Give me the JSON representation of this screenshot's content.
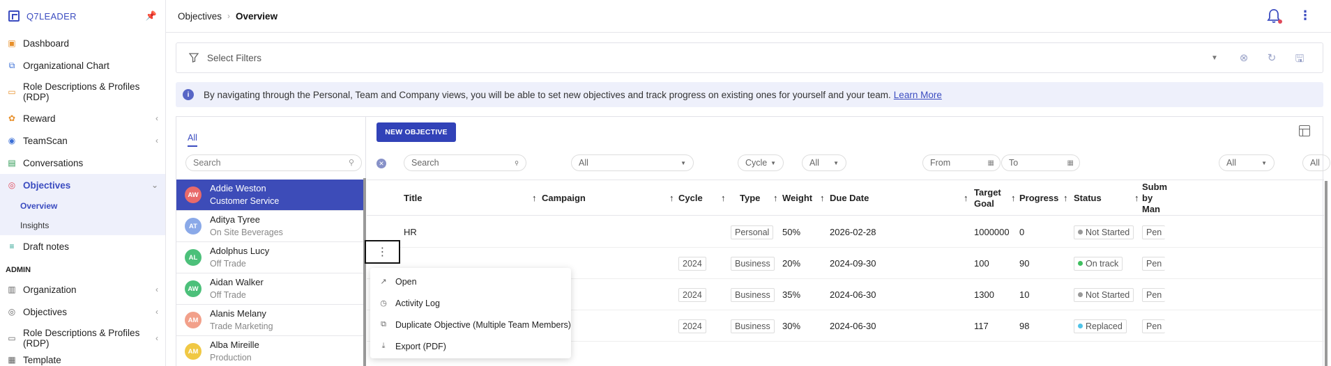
{
  "sidebar": {
    "brand": "Q7LEADER",
    "items": [
      {
        "label": "Dashboard"
      },
      {
        "label": "Organizational Chart"
      },
      {
        "label": "Role Descriptions & Profiles (RDP)"
      },
      {
        "label": "Reward"
      },
      {
        "label": "TeamScan"
      },
      {
        "label": "Conversations"
      },
      {
        "label": "Objectives"
      },
      {
        "label": "Draft notes"
      }
    ],
    "sub_items": [
      {
        "label": "Overview"
      },
      {
        "label": "Insights"
      }
    ],
    "admin_label": "ADMIN",
    "admin_items": [
      {
        "label": "Organization"
      },
      {
        "label": "Objectives"
      },
      {
        "label": "Role Descriptions & Profiles (RDP)"
      }
    ],
    "cut_item": "Template"
  },
  "topbar": {
    "crumb_parent": "Objectives",
    "crumb_current": "Overview"
  },
  "filters": {
    "label": "Select Filters"
  },
  "banner": {
    "text": "By navigating through the Personal, Team and Company views, you will be able to set new objectives and track progress on existing ones for yourself and your team.",
    "link": "Learn More"
  },
  "people_panel": {
    "tab": "All",
    "search_placeholder": "Search",
    "people": [
      {
        "initials": "AW",
        "name": "Addie Weston",
        "dept": "Customer Service",
        "color": "#e86a6a"
      },
      {
        "initials": "AT",
        "name": "Aditya Tyree",
        "dept": "On Site Beverages",
        "color": "#8aa9e8"
      },
      {
        "initials": "AL",
        "name": "Adolphus Lucy",
        "dept": "Off Trade",
        "color": "#4cc07a"
      },
      {
        "initials": "AW",
        "name": "Aidan Walker",
        "dept": "Off Trade",
        "color": "#4cc07a"
      },
      {
        "initials": "AM",
        "name": "Alanis Melany",
        "dept": "Trade Marketing",
        "color": "#f2a08a"
      },
      {
        "initials": "AM",
        "name": "Alba Mireille",
        "dept": "Production",
        "color": "#f0c844"
      }
    ]
  },
  "objectives": {
    "new_button": "NEW OBJECTIVE",
    "controls": {
      "search_placeholder": "Search",
      "campaign": "All",
      "cycle": "Cycle",
      "type": "All",
      "from": "From",
      "to": "To",
      "status": "All",
      "extra": "All"
    },
    "columns": {
      "title": "Title",
      "campaign": "Campaign",
      "cycle": "Cycle",
      "type": "Type",
      "weight": "Weight",
      "due": "Due Date",
      "target_1": "Target",
      "target_2": "Goal",
      "progress": "Progress",
      "status": "Status",
      "sub_1": "Subm",
      "sub_2": "by",
      "sub_3": "Man"
    },
    "rows": [
      {
        "title": "HR",
        "cycle": "",
        "type": "Personal",
        "weight": "50%",
        "due": "2026-02-28",
        "target": "1000000",
        "progress": "0",
        "status": "Not Started",
        "status_color": "#999999",
        "sub": "Pen"
      },
      {
        "title": "",
        "cycle": "2024",
        "type": "Business",
        "weight": "20%",
        "due": "2024-09-30",
        "target": "100",
        "progress": "90",
        "status": "On track",
        "status_color": "#3fbf5f",
        "sub": "Pen"
      },
      {
        "title": "",
        "cycle": "2024",
        "type": "Business",
        "weight": "35%",
        "due": "2024-06-30",
        "target": "1300",
        "progress": "10",
        "status": "Not Started",
        "status_color": "#999999",
        "sub": "Pen"
      },
      {
        "title": "",
        "cycle": "2024",
        "type": "Business",
        "weight": "30%",
        "due": "2024-06-30",
        "target": "117",
        "progress": "98",
        "status": "Replaced",
        "status_color": "#4fc3e8",
        "sub": "Pen"
      }
    ]
  },
  "context_menu": {
    "items": [
      {
        "label": "Open",
        "icon": "arrow-up-right-icon"
      },
      {
        "label": "Activity Log",
        "icon": "history-icon"
      },
      {
        "label": "Duplicate Objective (Multiple Team Members)",
        "icon": "duplicate-icon"
      },
      {
        "label": "Export (PDF)",
        "icon": "download-icon"
      }
    ]
  }
}
